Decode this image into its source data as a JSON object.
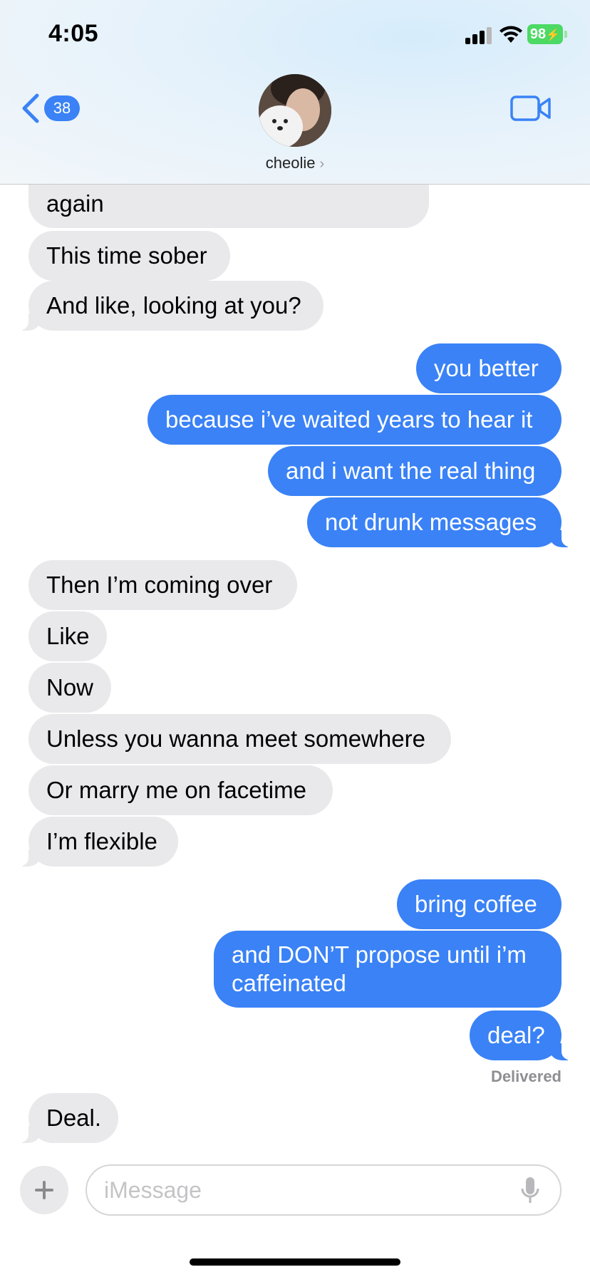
{
  "status_bar": {
    "time": "4:05",
    "battery": "98"
  },
  "header": {
    "back_count": "38",
    "contact_name": "cheolie",
    "contact_chevron": "›"
  },
  "messages": [
    {
      "from": "them",
      "text": "again"
    },
    {
      "from": "them",
      "text": "This time sober"
    },
    {
      "from": "them",
      "text": "And like, looking at you?"
    },
    {
      "from": "me",
      "text": "you better"
    },
    {
      "from": "me",
      "text": "because i’ve waited years to hear it"
    },
    {
      "from": "me",
      "text": "and i want the real thing"
    },
    {
      "from": "me",
      "text": "not drunk messages"
    },
    {
      "from": "them",
      "text": "Then I’m coming over"
    },
    {
      "from": "them",
      "text": "Like"
    },
    {
      "from": "them",
      "text": "Now"
    },
    {
      "from": "them",
      "text": "Unless you wanna meet somewhere"
    },
    {
      "from": "them",
      "text": "Or marry me on facetime"
    },
    {
      "from": "them",
      "text": "I’m flexible"
    },
    {
      "from": "me",
      "text": "bring coffee"
    },
    {
      "from": "me",
      "text": "and DON’T propose until i’m caffeinated"
    },
    {
      "from": "me",
      "text": "deal?"
    },
    {
      "from": "them",
      "text": "Deal."
    }
  ],
  "delivered_label": "Delivered",
  "input": {
    "placeholder": "iMessage"
  },
  "colors": {
    "accent": "#3a82f6",
    "incoming_bubble": "#e9e9eb",
    "battery": "#4cd964"
  }
}
